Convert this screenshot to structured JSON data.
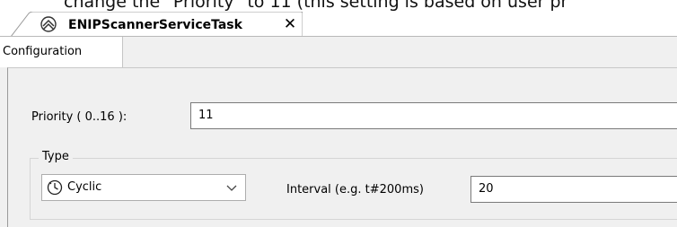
{
  "instruction_text": "change the \"Priority\" to 11 (this setting is based on user pr",
  "document_tab": {
    "title": "ENIPScannerServiceTask",
    "icon": "task-gears-icon",
    "close_glyph": "✕"
  },
  "config_tab": {
    "label": "Configuration"
  },
  "priority": {
    "label": "Priority ( 0..16 ):",
    "value": "11"
  },
  "type_group": {
    "legend": "Type",
    "select": {
      "value": "Cyclic",
      "icon": "clock-icon"
    }
  },
  "interval": {
    "label": "Interval (e.g. t#200ms)",
    "value": "20"
  },
  "colors": {
    "panel_background": "#f0f0f0",
    "border": "#7a7a7a"
  }
}
